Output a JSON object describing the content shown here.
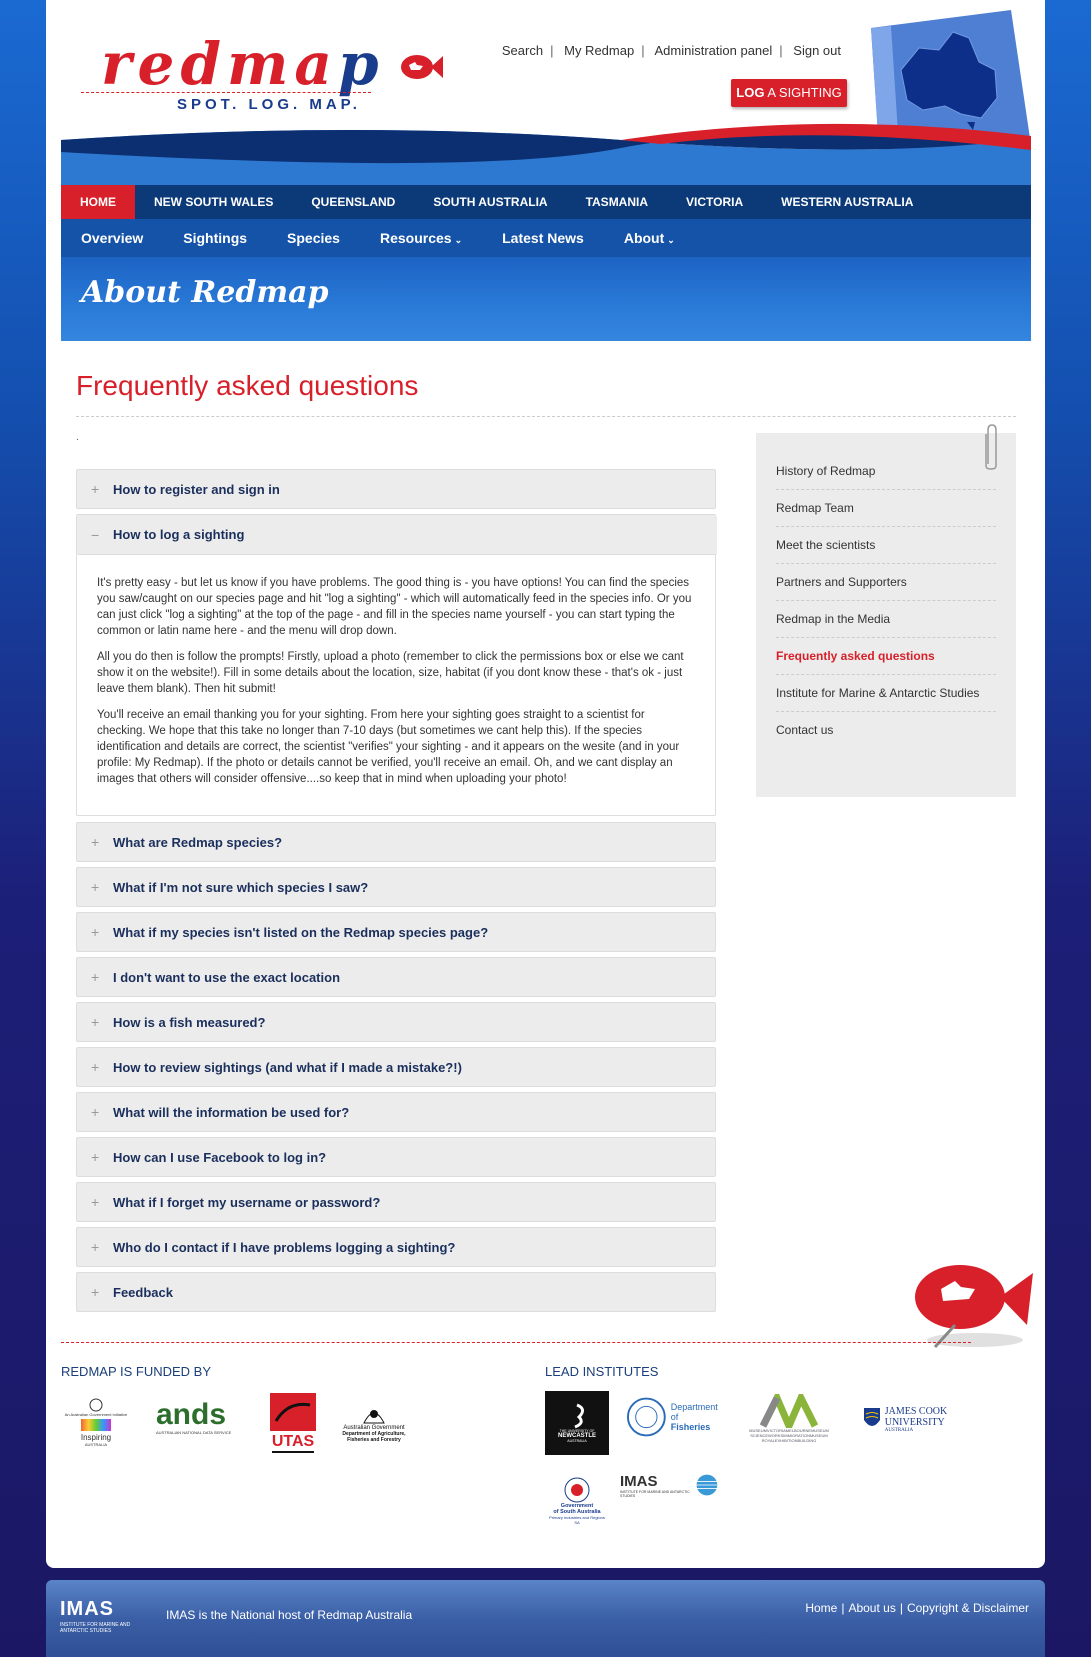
{
  "header": {
    "logo_word_red": "redma",
    "logo_word_blue": "p",
    "logo_tagline": "SPOT. LOG. MAP.",
    "top_links": [
      "Search",
      "My Redmap",
      "Administration panel",
      "Sign out"
    ],
    "log_sighting_bold": "LOG",
    "log_sighting_rest": " A SIGHTING"
  },
  "nav_states": [
    "HOME",
    "NEW SOUTH WALES",
    "QUEENSLAND",
    "SOUTH AUSTRALIA",
    "TASMANIA",
    "VICTORIA",
    "WESTERN AUSTRALIA"
  ],
  "nav_sections": [
    {
      "label": "Overview",
      "chevron": ""
    },
    {
      "label": "Sightings",
      "chevron": ""
    },
    {
      "label": "Species",
      "chevron": ""
    },
    {
      "label": "Resources",
      "chevron": "⌄"
    },
    {
      "label": "Latest News",
      "chevron": ""
    },
    {
      "label": "About",
      "chevron": "⌄"
    }
  ],
  "banner_title": "About Redmap",
  "page_title": "Frequently asked questions",
  "dot": ".",
  "faq": {
    "first": {
      "sign": "+",
      "question": "How to register and sign in"
    },
    "open": {
      "sign": "−",
      "question": "How to log a sighting",
      "paragraphs": [
        "It's pretty easy - but let us know if you have problems. The good thing is - you have options! You can find the species you saw/caught on our species page and hit \"log a sighting\" - which will automatically feed in the species info. Or you can just click \"log a sighting\" at the top of the page - and fill in the species name yourself - you can start typing the common or latin name here - and the menu will drop down.",
        "All you do then is follow the prompts! Firstly, upload a photo (remember to click the permissions box or else we cant show it on the website!). Fill in some details about the location, size, habitat (if you dont know these - that's ok - just leave them blank). Then hit submit!",
        "You'll receive an email thanking you for your sighting. From here your sighting goes straight to a scientist for checking. We hope that this take no longer than 7-10 days (but sometimes we cant help this). If the species identification and details are correct, the scientist \"verifies\" your sighting - and it appears on the wesite (and in your profile: My Redmap). If the photo or details cannot be verified, you'll receive an email. Oh, and we cant display an images that others will consider offensive....so keep that in mind when uploading your photo!"
      ]
    },
    "rest": [
      {
        "sign": "+",
        "question": "What are Redmap species?"
      },
      {
        "sign": "+",
        "question": "What if I'm not sure which species I saw?"
      },
      {
        "sign": "+",
        "question": "What if my species isn't listed on the Redmap species page?"
      },
      {
        "sign": "+",
        "question": "I don't want to use the exact location"
      },
      {
        "sign": "+",
        "question": "How is a fish measured?"
      },
      {
        "sign": "+",
        "question": "How to review sightings (and what if I made a mistake?!)"
      },
      {
        "sign": "+",
        "question": "What will the information be used for?"
      },
      {
        "sign": "+",
        "question": "How can I use Facebook to log in?"
      },
      {
        "sign": "+",
        "question": "What if I forget my username or password?"
      },
      {
        "sign": "+",
        "question": "Who do I contact if I have problems logging a sighting?"
      },
      {
        "sign": "+",
        "question": "Feedback"
      }
    ]
  },
  "sidebar": {
    "items": [
      "History of Redmap",
      "Redmap Team",
      "Meet the scientists",
      "Partners and Supporters",
      "Redmap in the Media",
      "Frequently asked questions",
      "Institute for Marine & Antarctic Studies",
      "Contact us"
    ],
    "active_index": 5
  },
  "funded": {
    "title": "REDMAP IS FUNDED BY",
    "logos": [
      {
        "line1": "An Australian Government Initiative",
        "line2": "Inspiring",
        "line3": "AUSTRALIA"
      },
      {
        "line1": "ands",
        "line2": "AUSTRALIAN NATIONAL DATA SERVICE"
      },
      {
        "line1": "UTAS"
      },
      {
        "line1": "Australian Government",
        "line2": "Department of Agriculture,",
        "line3": "Fisheries and Forestry"
      }
    ]
  },
  "lead": {
    "title": "LEAD INSTITUTES",
    "logos": {
      "newcastle": {
        "line1": "THE UNIVERSITY OF",
        "line2": "NEWCASTLE",
        "line3": "AUSTRALIA"
      },
      "fisheries": {
        "line1": "Department of",
        "line2": "Fisheries"
      },
      "museum": {
        "line1": "MUSEUMVICTORIAMELBOURNEMUSEUM",
        "line2": "SCIENCEWORKSIMMIGRATIONMUSEUM",
        "line3": "ROYALEXHIBITIONBUILDING"
      },
      "jcu": {
        "line1": "JAMES COOK",
        "line2": "UNIVERSITY",
        "line3": "AUSTRALIA"
      },
      "sa_gov": {
        "line1": "Government",
        "line2": "of South Australia",
        "line3": "Primary Industries and Regions SA"
      },
      "imas": {
        "line1": "IMAS",
        "line2": "INSTITUTE FOR MARINE AND ANTARCTIC STUDIES"
      }
    }
  },
  "footer": {
    "imas": "IMAS",
    "imas_sub": "INSTITUTE FOR MARINE AND ANTARCTIC STUDIES",
    "text": "IMAS is the National host of Redmap Australia",
    "links": [
      "Home",
      "About us",
      "Copyright & Disclaimer"
    ]
  },
  "colors": {
    "brand_red": "#d8202a",
    "brand_blue": "#1a3c8c",
    "nav_dark": "#0c3a78",
    "nav_mid": "#1453a8"
  }
}
